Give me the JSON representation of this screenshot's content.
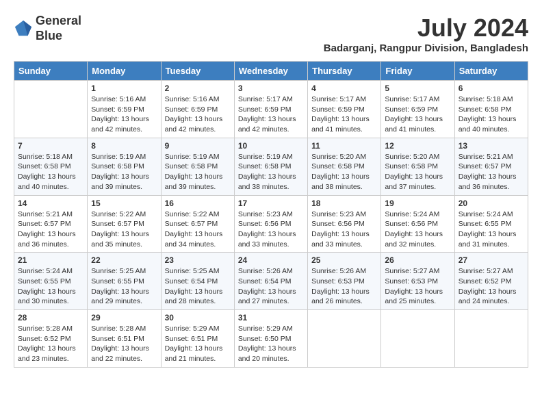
{
  "header": {
    "logo_line1": "General",
    "logo_line2": "Blue",
    "month_year": "July 2024",
    "location": "Badarganj, Rangpur Division, Bangladesh"
  },
  "days_of_week": [
    "Sunday",
    "Monday",
    "Tuesday",
    "Wednesday",
    "Thursday",
    "Friday",
    "Saturday"
  ],
  "weeks": [
    [
      {
        "day": "",
        "info": ""
      },
      {
        "day": "1",
        "info": "Sunrise: 5:16 AM\nSunset: 6:59 PM\nDaylight: 13 hours\nand 42 minutes."
      },
      {
        "day": "2",
        "info": "Sunrise: 5:16 AM\nSunset: 6:59 PM\nDaylight: 13 hours\nand 42 minutes."
      },
      {
        "day": "3",
        "info": "Sunrise: 5:17 AM\nSunset: 6:59 PM\nDaylight: 13 hours\nand 42 minutes."
      },
      {
        "day": "4",
        "info": "Sunrise: 5:17 AM\nSunset: 6:59 PM\nDaylight: 13 hours\nand 41 minutes."
      },
      {
        "day": "5",
        "info": "Sunrise: 5:17 AM\nSunset: 6:59 PM\nDaylight: 13 hours\nand 41 minutes."
      },
      {
        "day": "6",
        "info": "Sunrise: 5:18 AM\nSunset: 6:58 PM\nDaylight: 13 hours\nand 40 minutes."
      }
    ],
    [
      {
        "day": "7",
        "info": ""
      },
      {
        "day": "8",
        "info": "Sunrise: 5:19 AM\nSunset: 6:58 PM\nDaylight: 13 hours\nand 39 minutes."
      },
      {
        "day": "9",
        "info": "Sunrise: 5:19 AM\nSunset: 6:58 PM\nDaylight: 13 hours\nand 39 minutes."
      },
      {
        "day": "10",
        "info": "Sunrise: 5:19 AM\nSunset: 6:58 PM\nDaylight: 13 hours\nand 38 minutes."
      },
      {
        "day": "11",
        "info": "Sunrise: 5:20 AM\nSunset: 6:58 PM\nDaylight: 13 hours\nand 38 minutes."
      },
      {
        "day": "12",
        "info": "Sunrise: 5:20 AM\nSunset: 6:58 PM\nDaylight: 13 hours\nand 37 minutes."
      },
      {
        "day": "13",
        "info": "Sunrise: 5:21 AM\nSunset: 6:57 PM\nDaylight: 13 hours\nand 36 minutes."
      }
    ],
    [
      {
        "day": "14",
        "info": ""
      },
      {
        "day": "15",
        "info": "Sunrise: 5:22 AM\nSunset: 6:57 PM\nDaylight: 13 hours\nand 35 minutes."
      },
      {
        "day": "16",
        "info": "Sunrise: 5:22 AM\nSunset: 6:57 PM\nDaylight: 13 hours\nand 34 minutes."
      },
      {
        "day": "17",
        "info": "Sunrise: 5:23 AM\nSunset: 6:56 PM\nDaylight: 13 hours\nand 33 minutes."
      },
      {
        "day": "18",
        "info": "Sunrise: 5:23 AM\nSunset: 6:56 PM\nDaylight: 13 hours\nand 33 minutes."
      },
      {
        "day": "19",
        "info": "Sunrise: 5:24 AM\nSunset: 6:56 PM\nDaylight: 13 hours\nand 32 minutes."
      },
      {
        "day": "20",
        "info": "Sunrise: 5:24 AM\nSunset: 6:55 PM\nDaylight: 13 hours\nand 31 minutes."
      }
    ],
    [
      {
        "day": "21",
        "info": ""
      },
      {
        "day": "22",
        "info": "Sunrise: 5:25 AM\nSunset: 6:55 PM\nDaylight: 13 hours\nand 29 minutes."
      },
      {
        "day": "23",
        "info": "Sunrise: 5:25 AM\nSunset: 6:54 PM\nDaylight: 13 hours\nand 28 minutes."
      },
      {
        "day": "24",
        "info": "Sunrise: 5:26 AM\nSunset: 6:54 PM\nDaylight: 13 hours\nand 27 minutes."
      },
      {
        "day": "25",
        "info": "Sunrise: 5:26 AM\nSunset: 6:53 PM\nDaylight: 13 hours\nand 26 minutes."
      },
      {
        "day": "26",
        "info": "Sunrise: 5:27 AM\nSunset: 6:53 PM\nDaylight: 13 hours\nand 25 minutes."
      },
      {
        "day": "27",
        "info": "Sunrise: 5:27 AM\nSunset: 6:52 PM\nDaylight: 13 hours\nand 24 minutes."
      }
    ],
    [
      {
        "day": "28",
        "info": "Sunrise: 5:28 AM\nSunset: 6:52 PM\nDaylight: 13 hours\nand 23 minutes."
      },
      {
        "day": "29",
        "info": "Sunrise: 5:28 AM\nSunset: 6:51 PM\nDaylight: 13 hours\nand 22 minutes."
      },
      {
        "day": "30",
        "info": "Sunrise: 5:29 AM\nSunset: 6:51 PM\nDaylight: 13 hours\nand 21 minutes."
      },
      {
        "day": "31",
        "info": "Sunrise: 5:29 AM\nSunset: 6:50 PM\nDaylight: 13 hours\nand 20 minutes."
      },
      {
        "day": "",
        "info": ""
      },
      {
        "day": "",
        "info": ""
      },
      {
        "day": "",
        "info": ""
      }
    ]
  ],
  "week7_sunday": "Sunrise: 5:18 AM\nSunset: 6:58 PM\nDaylight: 13 hours\nand 40 minutes.",
  "week14_sunday": "Sunrise: 5:21 AM\nSunset: 6:57 PM\nDaylight: 13 hours\nand 36 minutes.",
  "week21_sunday": "Sunrise: 5:24 AM\nSunset: 6:55 PM\nDaylight: 13 hours\nand 30 minutes."
}
